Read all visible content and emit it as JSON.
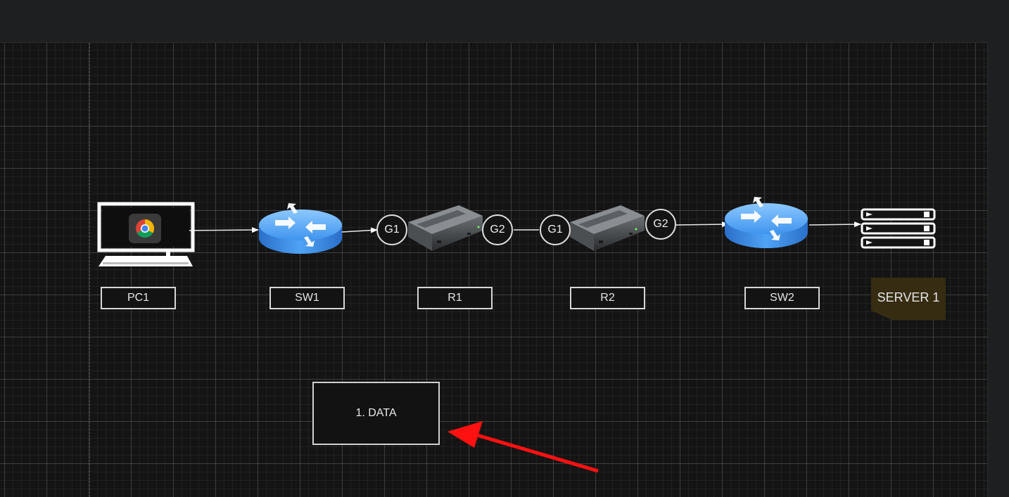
{
  "diagram": {
    "nodes": [
      {
        "id": "pc1",
        "label": "PC1",
        "icon": "desktop-computer-chrome-icon"
      },
      {
        "id": "sw1",
        "label": "SW1",
        "icon": "router-icon"
      },
      {
        "id": "r1",
        "label": "R1",
        "icon": "network-device-icon"
      },
      {
        "id": "r2",
        "label": "R2",
        "icon": "network-device-icon"
      },
      {
        "id": "sw2",
        "label": "SW2",
        "icon": "router-icon"
      },
      {
        "id": "server1",
        "label": "SERVER 1",
        "icon": "server-rack-icon"
      }
    ],
    "interfaces": [
      {
        "device": "r1",
        "side": "left",
        "label": "G1"
      },
      {
        "device": "r1",
        "side": "right",
        "label": "G2"
      },
      {
        "device": "r2",
        "side": "left",
        "label": "G1"
      },
      {
        "device": "r2",
        "side": "right",
        "label": "G2"
      }
    ],
    "edges": [
      {
        "from": "pc1",
        "to": "sw1",
        "arrow": true
      },
      {
        "from": "sw1",
        "to": "r1",
        "arrow": true
      },
      {
        "from": "r1",
        "to": "r2",
        "arrow": false
      },
      {
        "from": "r2",
        "to": "sw2",
        "arrow": true
      },
      {
        "from": "sw2",
        "to": "server1",
        "arrow": true
      }
    ],
    "callout": {
      "label": "1. DATA",
      "pointer_color": "#ff1111"
    }
  },
  "colors": {
    "canvas_background": "#141414",
    "router_blue": "#3d8ff0",
    "server_note": "#352c12",
    "pointer": "#ff1111"
  }
}
